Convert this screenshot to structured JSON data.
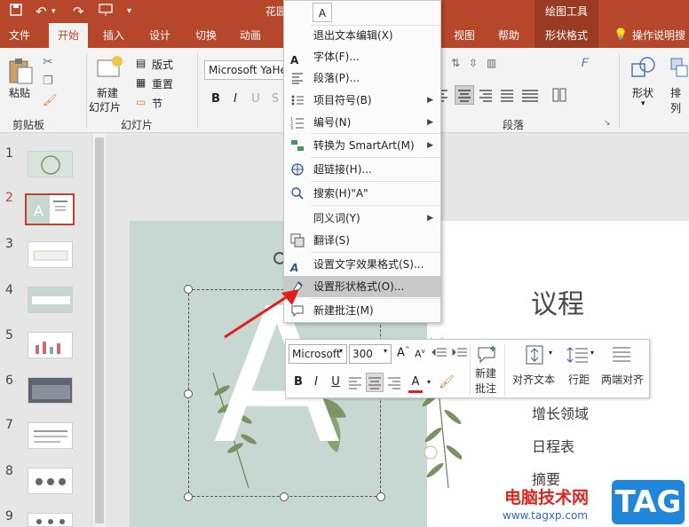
{
  "titlebar": {
    "title": "花园",
    "context_tab_group": "绘图工具"
  },
  "tabs": [
    {
      "label": "文件"
    },
    {
      "label": "开始"
    },
    {
      "label": "插入"
    },
    {
      "label": "设计"
    },
    {
      "label": "切换"
    },
    {
      "label": "动画"
    },
    {
      "label": "视图"
    },
    {
      "label": "帮助"
    },
    {
      "label": "形状格式"
    },
    {
      "label": "操作说明搜"
    }
  ],
  "ribbon": {
    "clipboard": {
      "paste": "粘贴",
      "group": "剪贴板"
    },
    "slides": {
      "new_slide_1": "新建",
      "new_slide_2": "幻灯片",
      "layout": "版式",
      "reset": "重置",
      "section": "节",
      "group": "幻灯片"
    },
    "font": {
      "font_name": "Microsoft YaHe",
      "bold": "B",
      "italic": "I"
    },
    "paragraph": {
      "group": "段落"
    },
    "drawing": {
      "shapes": "形状",
      "arrange": "排列"
    }
  },
  "context_menu": {
    "items": [
      {
        "label": "退出文本编辑(X)",
        "icon": "none"
      },
      {
        "label": "字体(F)...",
        "icon": "font-icon"
      },
      {
        "label": "段落(P)...",
        "icon": "paragraph-icon"
      },
      {
        "label": "项目符号(B)",
        "icon": "bullets-icon",
        "submenu": true
      },
      {
        "label": "编号(N)",
        "icon": "numbering-icon",
        "submenu": true
      },
      {
        "label": "转换为 SmartArt(M)",
        "icon": "smartart-icon",
        "submenu": true
      },
      {
        "label": "超链接(H)...",
        "icon": "hyperlink-icon"
      },
      {
        "label": "搜索(H)\"A\"",
        "icon": "search-icon"
      },
      {
        "label": "同义词(Y)",
        "icon": "none",
        "submenu": true
      },
      {
        "label": "翻译(S)",
        "icon": "translate-icon"
      },
      {
        "label": "设置文字效果格式(S)...",
        "icon": "text-effects-icon"
      },
      {
        "label": "设置形状格式(O)...",
        "icon": "format-shape-icon",
        "highlighted": true
      },
      {
        "label": "新建批注(M)",
        "icon": "comment-icon"
      }
    ]
  },
  "mini_toolbar": {
    "font": "Microsoft",
    "size": "300",
    "bold": "B",
    "italic": "I",
    "underline": "U",
    "font_color_letter": "A",
    "new_comment_1": "新建",
    "new_comment_2": "批注",
    "align_text": "对齐文本",
    "line_spacing": "行距",
    "justify": "两端对齐"
  },
  "slides_pane": {
    "numbers": [
      "1",
      "2",
      "3",
      "4",
      "5",
      "6",
      "7",
      "8",
      "9"
    ],
    "selected": "2"
  },
  "slide": {
    "big_letter": "A",
    "title": "议程",
    "items": [
      "增长领域",
      "日程表",
      "摘要"
    ]
  },
  "watermark": {
    "site_cn": "电脑技术网",
    "url": "www.tagxp.com",
    "badge": "TAG"
  },
  "colors": {
    "accent": "#b7472a",
    "slide_left": "#c7d7d1",
    "highlight": "#c9c9c9"
  }
}
